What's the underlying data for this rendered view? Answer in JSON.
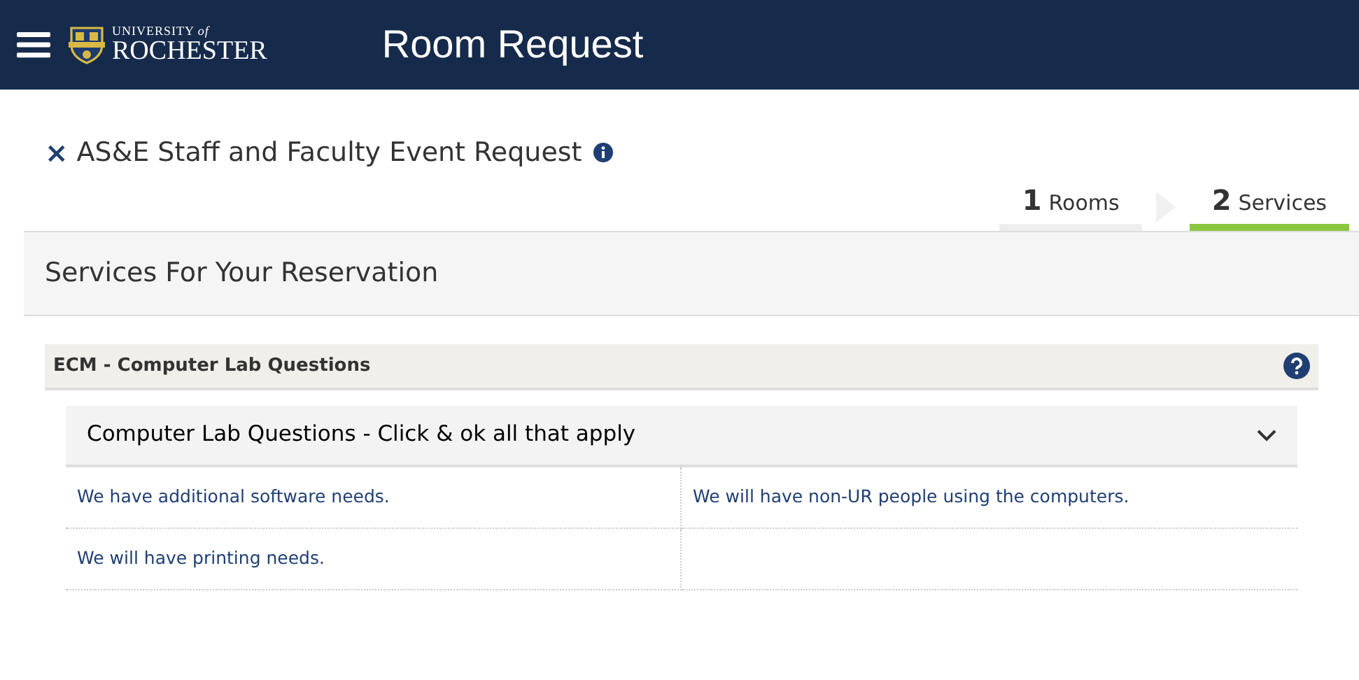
{
  "header": {
    "logo_top": "UNIVERSITY *of*",
    "logo_name": "ROCHESTER",
    "title": "Room Request"
  },
  "request": {
    "close": "×",
    "title": "AS&E Staff and Faculty Event Request"
  },
  "steps": [
    {
      "number": "1",
      "label": "Rooms",
      "selected": false
    },
    {
      "number": "2",
      "label": "Services",
      "selected": true
    }
  ],
  "section_title": "Services For Your Reservation",
  "service": {
    "title": "ECM - Computer Lab Questions",
    "question": {
      "title": "Computer Lab Questions - Click & ok all that apply",
      "expanded": true,
      "options": [
        "We have additional software needs.",
        "We will have non-UR people using the computers.",
        "We will have printing needs."
      ]
    }
  }
}
